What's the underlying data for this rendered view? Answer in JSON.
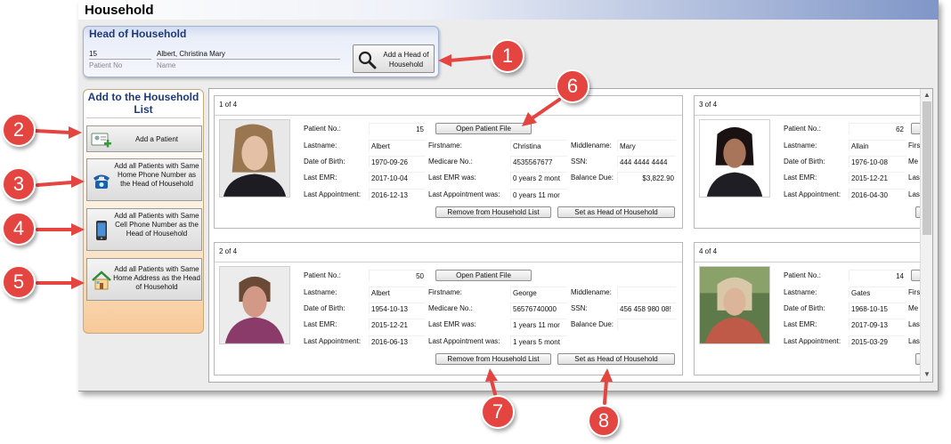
{
  "window": {
    "title": "Household"
  },
  "head_of_household": {
    "header": "Head of Household",
    "patient_no": "15",
    "patient_no_label": "Patient No",
    "name": "Albert, Christina Mary",
    "name_label": "Name",
    "add_button": "Add a Head of Household"
  },
  "sidebar": {
    "header": "Add to the Household List",
    "buttons": [
      {
        "label": "Add a Patient",
        "icon": "add-patient-icon"
      },
      {
        "label": "Add all Patients with Same Home Phone Number as the Head of Household",
        "icon": "home-phone-icon"
      },
      {
        "label": "Add all Patients with Same Cell Phone Number as the Head of Household",
        "icon": "cell-phone-icon"
      },
      {
        "label": "Add all Patients with Same Home Address as the Head of Household",
        "icon": "house-icon"
      }
    ]
  },
  "labels": {
    "patient_no": "Patient No.:",
    "lastname": "Lastname:",
    "firstname": "Firstname:",
    "middlename": "Middlename:",
    "dob": "Date of Birth:",
    "medicare": "Medicare No.:",
    "ssn": "SSN:",
    "last_emr": "Last EMR:",
    "last_emr_was": "Last EMR was:",
    "balance": "Balance Due:",
    "last_appt": "Last Appointment:",
    "last_appt_was": "Last Appointment was:",
    "open_file": "Open Patient File",
    "remove": "Remove from Household List",
    "set_head": "Set as Head of Household"
  },
  "cards": [
    {
      "count": "1 of 4",
      "patient_no": "15",
      "lastname": "Albert",
      "firstname": "Christina",
      "middlename": "Mary",
      "dob": "1970-09-26",
      "medicare": "4535567677",
      "ssn": "444 4444 4444",
      "last_emr": "2017-10-04",
      "last_emr_was": "0 years  2 mont",
      "balance": "$3,822.90",
      "last_appt": "2016-12-13",
      "last_appt_was": "0 years  11 mor"
    },
    {
      "count": "2 of 4",
      "patient_no": "50",
      "lastname": "Albert",
      "firstname": "George",
      "middlename": "",
      "dob": "1954-10-13",
      "medicare": "56576740000",
      "ssn": "456 458 980 08!",
      "last_emr": "2015-12-21",
      "last_emr_was": "1 years  11 mor",
      "balance": "",
      "last_appt": "2016-06-13",
      "last_appt_was": "1 years  5 mont"
    },
    {
      "count": "3 of 4",
      "patient_no": "62",
      "lastname": "Allain",
      "firstname_cut": "Firs",
      "dob": "1976-10-08",
      "medicare_cut": "Me",
      "last_emr": "2015-12-21",
      "last_emr_cut": "Las",
      "last_appt": "2016-04-30",
      "last_appt_cut": "Las"
    },
    {
      "count": "4 of 4",
      "patient_no": "14",
      "lastname": "Gates",
      "firstname_cut": "Firs",
      "dob": "1968-10-15",
      "medicare_cut": "Me",
      "last_emr": "2017-09-13",
      "last_emr_cut": "Las",
      "last_appt": "2015-03-29",
      "last_appt_cut": "Las"
    }
  ],
  "callouts": [
    "1",
    "2",
    "3",
    "4",
    "5",
    "6",
    "7",
    "8"
  ],
  "colors": {
    "callout": "#e54540",
    "header_blue": "#1f3a78"
  }
}
